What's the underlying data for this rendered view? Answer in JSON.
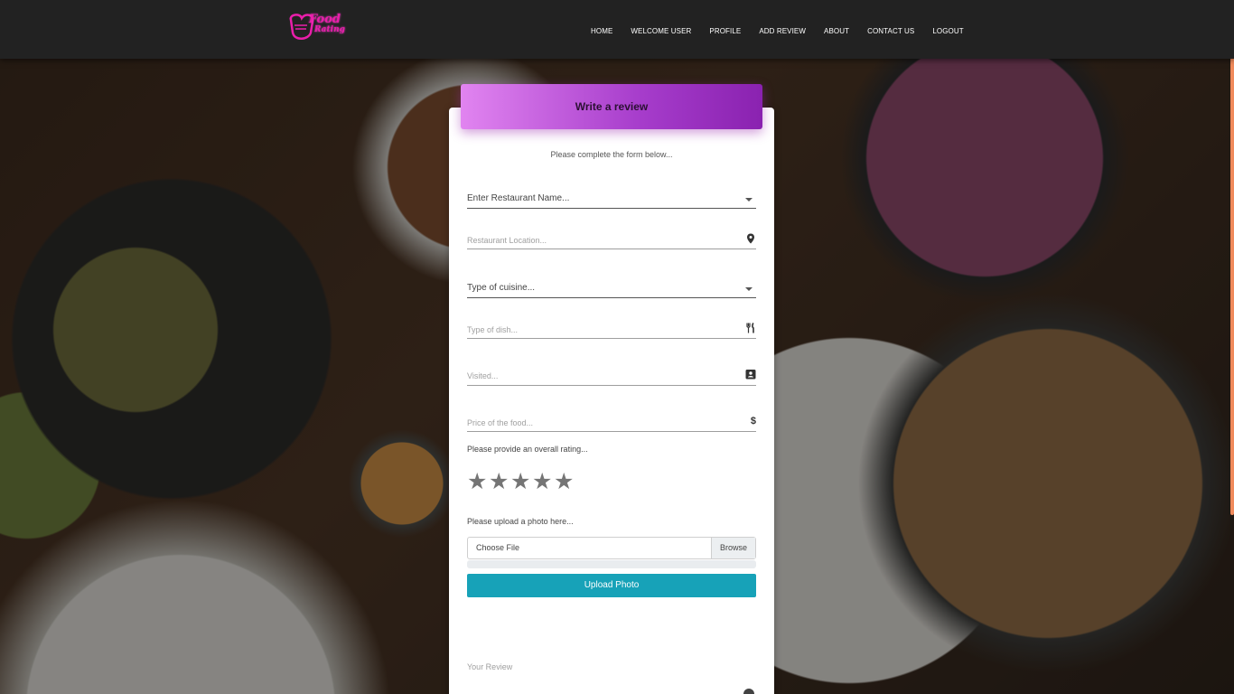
{
  "brand": {
    "name_line1": "Food",
    "name_line2": "Rating",
    "logo_icon": "chef-hat-icon",
    "color": "#e91eaa"
  },
  "nav": {
    "items": [
      "HOME",
      "WELCOME USER",
      "PROFILE",
      "ADD REVIEW",
      "ABOUT",
      "CONTACT US",
      "LOGOUT"
    ]
  },
  "form": {
    "title": "Write a review",
    "subtitle": "Please complete the form below...",
    "restaurant_name_placeholder": "Enter Restaurant Name...",
    "restaurant_location_placeholder": "Restaurant Location...",
    "cuisine_placeholder": "Type of cuisine...",
    "dish_placeholder": "Type of dish...",
    "visited_placeholder": "Visited...",
    "price_placeholder": "Price of the food...",
    "rating_label": "Please provide an overall rating...",
    "rating_max": 5,
    "rating_value": 0,
    "star_glyph": "★",
    "upload_label": "Please upload a photo here...",
    "choose_file": "Choose File",
    "browse": "Browse",
    "upload_button": "Upload Photo",
    "review_label": "Your Review",
    "icons": {
      "location": "map-marker-icon",
      "dish": "fork-knife-icon",
      "visited": "contact-calendar-icon",
      "price": "dollar-icon"
    },
    "header_gradient": [
      "#e184f0",
      "#8a22b0"
    ],
    "button_color": "#17a2b8"
  }
}
